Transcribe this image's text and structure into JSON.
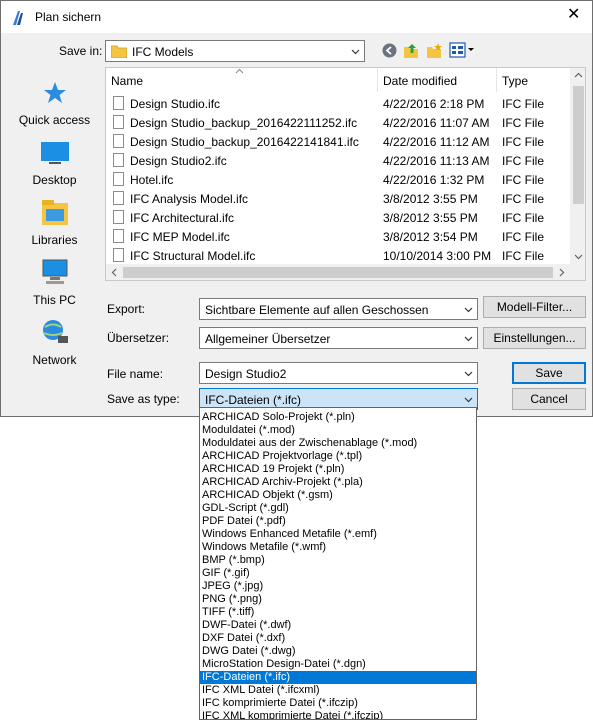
{
  "window": {
    "title": "Plan sichern",
    "close_glyph": "✕"
  },
  "location": {
    "label": "Save in:",
    "value": "IFC Models"
  },
  "toolbar": {
    "icons": [
      "back-icon",
      "up-folder-icon",
      "new-folder-icon",
      "view-menu-icon"
    ]
  },
  "places": [
    {
      "label": "Quick access",
      "icon": "star-icon"
    },
    {
      "label": "Desktop",
      "icon": "desktop-icon"
    },
    {
      "label": "Libraries",
      "icon": "libraries-icon"
    },
    {
      "label": "This PC",
      "icon": "this-pc-icon"
    },
    {
      "label": "Network",
      "icon": "network-icon"
    }
  ],
  "file_list": {
    "columns": {
      "name": "Name",
      "date": "Date modified",
      "type": "Type"
    },
    "rows": [
      {
        "name": "Design Studio.ifc",
        "date": "4/22/2016 2:18 PM",
        "type": "IFC File"
      },
      {
        "name": "Design Studio_backup_2016422111252.ifc",
        "date": "4/22/2016 11:07 AM",
        "type": "IFC File"
      },
      {
        "name": "Design Studio_backup_2016422141841.ifc",
        "date": "4/22/2016 11:12 AM",
        "type": "IFC File"
      },
      {
        "name": "Design Studio2.ifc",
        "date": "4/22/2016 11:13 AM",
        "type": "IFC File"
      },
      {
        "name": "Hotel.ifc",
        "date": "4/22/2016 1:32 PM",
        "type": "IFC File"
      },
      {
        "name": "IFC Analysis Model.ifc",
        "date": "3/8/2012 3:55 PM",
        "type": "IFC File"
      },
      {
        "name": "IFC Architectural.ifc",
        "date": "3/8/2012 3:55 PM",
        "type": "IFC File"
      },
      {
        "name": "IFC MEP Model.ifc",
        "date": "3/8/2012 3:54 PM",
        "type": "IFC File"
      },
      {
        "name": "IFC Structural Model.ifc",
        "date": "10/10/2014 3:00 PM",
        "type": "IFC File"
      }
    ]
  },
  "export": {
    "label": "Export:",
    "value": "Sichtbare Elemente auf allen Geschossen",
    "button": "Modell-Filter..."
  },
  "translator": {
    "label": "Übersetzer:",
    "value": "Allgemeiner Übersetzer",
    "button": "Einstellungen..."
  },
  "filename": {
    "label": "File name:",
    "value": "Design Studio2",
    "button": "Save"
  },
  "filetype": {
    "label": "Save as type:",
    "value": "IFC-Dateien (*.ifc)",
    "button": "Cancel",
    "options": [
      "ARCHICAD Solo-Projekt (*.pln)",
      "Moduldatei (*.mod)",
      "Moduldatei aus der Zwischenablage (*.mod)",
      "ARCHICAD Projektvorlage (*.tpl)",
      "ARCHICAD 19 Projekt (*.pln)",
      "ARCHICAD Archiv-Projekt (*.pla)",
      "ARCHICAD Objekt (*.gsm)",
      "GDL-Script (*.gdl)",
      "PDF Datei (*.pdf)",
      "Windows Enhanced Metafile (*.emf)",
      "Windows Metafile (*.wmf)",
      "BMP (*.bmp)",
      "GIF (*.gif)",
      "JPEG (*.jpg)",
      "PNG (*.png)",
      "TIFF (*.tiff)",
      "DWF-Datei (*.dwf)",
      "DXF Datei (*.dxf)",
      "DWG Datei (*.dwg)",
      "MicroStation Design-Datei (*.dgn)",
      "IFC-Dateien (*.ifc)",
      "IFC XML Datei (*.ifcxml)",
      "IFC komprimierte Datei (*.ifczip)",
      "IFC XML komprimierte Datei (*.ifczip)"
    ],
    "selected_index": 20
  },
  "colors": {
    "selection": "#0078d7",
    "dialog_bg": "#f0f0f0"
  }
}
